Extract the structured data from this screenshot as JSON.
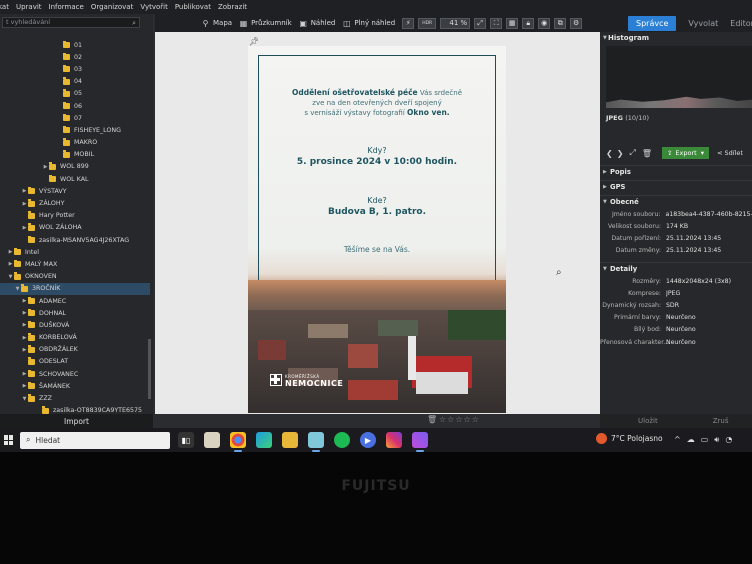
{
  "menu": [
    "kat",
    "Upravit",
    "Informace",
    "Organizovat",
    "Vytvořit",
    "Publikovat",
    "Zobrazit"
  ],
  "search": {
    "placeholder": "t vyhledávání"
  },
  "toolbar": {
    "map": "Mapa",
    "explorer": "Průzkumník",
    "preview": "Náhled",
    "fullpreview": "Plný náhled",
    "zoom": "41 %",
    "quality_badge": "HDR"
  },
  "modes": {
    "manager": "Správce",
    "develop": "Vyvolat",
    "editor": "Editor"
  },
  "tree": [
    {
      "label": "01",
      "indent": 8,
      "arrow": ""
    },
    {
      "label": "02",
      "indent": 8,
      "arrow": ""
    },
    {
      "label": "03",
      "indent": 8,
      "arrow": ""
    },
    {
      "label": "04",
      "indent": 8,
      "arrow": ""
    },
    {
      "label": "05",
      "indent": 8,
      "arrow": ""
    },
    {
      "label": "06",
      "indent": 8,
      "arrow": ""
    },
    {
      "label": "07",
      "indent": 8,
      "arrow": ""
    },
    {
      "label": "FISHEYE_LONG",
      "indent": 8,
      "arrow": ""
    },
    {
      "label": "MAKRO",
      "indent": 8,
      "arrow": ""
    },
    {
      "label": "MOBIL",
      "indent": 8,
      "arrow": ""
    },
    {
      "label": "WOL 899",
      "indent": 6,
      "arrow": "▶"
    },
    {
      "label": "WOL KAL",
      "indent": 6,
      "arrow": ""
    },
    {
      "label": "VÝSTAVY",
      "indent": 3,
      "arrow": "▶"
    },
    {
      "label": "ZÁLOHY",
      "indent": 3,
      "arrow": "▶"
    },
    {
      "label": "Hary Potter",
      "indent": 3,
      "arrow": ""
    },
    {
      "label": "WOL ZÁLOHA",
      "indent": 3,
      "arrow": "▶"
    },
    {
      "label": "zasilka-MSANV5AG4J26XTAG",
      "indent": 3,
      "arrow": ""
    },
    {
      "label": "Intel",
      "indent": 1,
      "arrow": "▶"
    },
    {
      "label": "MALÝ MAX",
      "indent": 1,
      "arrow": "▶"
    },
    {
      "label": "OKNOVEN",
      "indent": 1,
      "arrow": "▼"
    },
    {
      "label": "3ROČNÍK",
      "indent": 2,
      "arrow": "▼",
      "selected": true
    },
    {
      "label": "ADAMEC",
      "indent": 3,
      "arrow": "▶"
    },
    {
      "label": "DOHNAL",
      "indent": 3,
      "arrow": "▶"
    },
    {
      "label": "DUŠKOVÁ",
      "indent": 3,
      "arrow": "▶"
    },
    {
      "label": "KORBELOVÁ",
      "indent": 3,
      "arrow": "▶"
    },
    {
      "label": "OBDRŽÁLEK",
      "indent": 3,
      "arrow": "▶"
    },
    {
      "label": "ODESLAT",
      "indent": 3,
      "arrow": ""
    },
    {
      "label": "SCHOVANEC",
      "indent": 3,
      "arrow": "▶"
    },
    {
      "label": "ŠAMÁNEK",
      "indent": 3,
      "arrow": "▶"
    },
    {
      "label": "ZZZ",
      "indent": 3,
      "arrow": "▼"
    },
    {
      "label": "zasilka-OT8839CA9YTE6575",
      "indent": 5,
      "arrow": ""
    }
  ],
  "sidebar": {
    "import_label": "Import"
  },
  "poster": {
    "intro_bold": "Oddělení ošetřovatelské péče",
    "intro_rest_1": " Vás srdečně",
    "intro_line2": "zve na den otevřených dveří spojený",
    "intro_line3_a": "s vernisáží výstavy fotografií ",
    "intro_line3_b": "Okno ven.",
    "when_q": "Kdy?",
    "when_a": "5. prosince 2024 v 10:00 hodin.",
    "where_q": "Kde?",
    "where_a": "Budova B, 1. patro.",
    "bye": "Těšíme se na Vás.",
    "logo_small": "KROMĚŘÍŽSKÁ",
    "logo_big": "NEMOCNICE"
  },
  "right": {
    "histogram": "Histogram",
    "format": "JPEG",
    "format_count": "(10/10)",
    "export": "Export",
    "share": "Sdílet",
    "sections": {
      "popis": "Popis",
      "gps": "GPS",
      "obecne": "Obecné",
      "detaily": "Detaily"
    },
    "general": [
      {
        "k": "Jméno souboru:",
        "v": "a183bea4-4387-460b-8215-"
      },
      {
        "k": "Velikost souboru:",
        "v": "174 KB"
      },
      {
        "k": "Datum pořízení:",
        "v": "25.11.2024 13:45"
      },
      {
        "k": "Datum změny:",
        "v": "25.11.2024 13:45"
      }
    ],
    "details": [
      {
        "k": "Rozměry:",
        "v": "1448x2048x24 (3x8)"
      },
      {
        "k": "Komprese:",
        "v": "JPEG"
      },
      {
        "k": "Dynamický rozsah:",
        "v": "SDR"
      },
      {
        "k": "Primární barvy:",
        "v": "Neurčeno"
      },
      {
        "k": "Bílý bod:",
        "v": "Neurčeno"
      },
      {
        "k": "Přenosová charakter...",
        "v": "Neurčeno"
      }
    ],
    "bottom_save": "Uložit",
    "bottom_reset": "Zruš"
  },
  "taskbar": {
    "search": "Hledat",
    "temp": "7°C",
    "weather": "Polojasno"
  },
  "bezel": {
    "brand": "FUJITSU"
  },
  "colors": {
    "accent": "#2b7fd4",
    "folder": "#e8b830",
    "export": "#3a8a3a",
    "poster_teal": "#1e5560"
  }
}
